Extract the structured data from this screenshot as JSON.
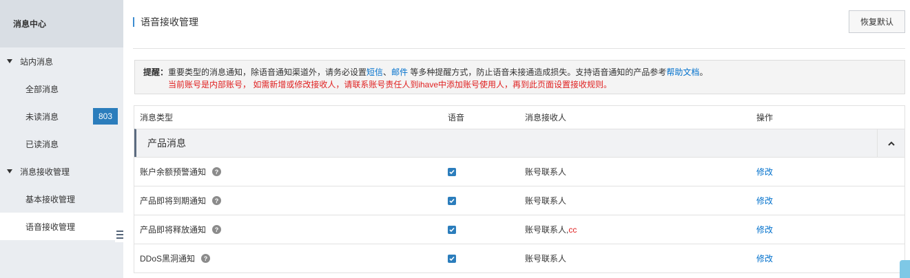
{
  "sidebar": {
    "title": "消息中心",
    "groups": [
      {
        "label": "站内消息"
      },
      {
        "label": "消息接收管理"
      }
    ],
    "items": [
      {
        "label": "全部消息"
      },
      {
        "label": "未读消息",
        "badge": "803"
      },
      {
        "label": "已读消息"
      },
      {
        "label": "基本接收管理"
      },
      {
        "label": "语音接收管理"
      }
    ]
  },
  "header": {
    "title": "语音接收管理",
    "restore_button": "恢复默认"
  },
  "tip": {
    "label": "提醒：",
    "text_before": "重要类型的消息通知，除语音通知渠道外，请务必设置",
    "link_sms": "短信",
    "sep": "、",
    "link_mail": "邮件",
    "text_mid": " 等多种提醒方式，防止语音未接通造成损失。支持语音通知的产品参考",
    "link_help": "帮助文档",
    "text_end": "。",
    "warning": "当前账号是内部账号， 如需新增或修改接收人，请联系账号责任人到ihave中添加账号使用人，再到此页面设置接收规则。"
  },
  "table": {
    "columns": [
      "消息类型",
      "语音",
      "消息接收人",
      "操作"
    ],
    "group_title": "产品消息",
    "rows": [
      {
        "type": "账户余额预警通知",
        "voice": true,
        "receiver": "账号联系人",
        "receiver_extra": "",
        "action": "修改"
      },
      {
        "type": "产品即将到期通知",
        "voice": true,
        "receiver": "账号联系人",
        "receiver_extra": "",
        "action": "修改"
      },
      {
        "type": "产品即将释放通知",
        "voice": true,
        "receiver": "账号联系人,",
        "receiver_extra": "cc",
        "action": "修改"
      },
      {
        "type": "DDoS黑洞通知",
        "voice": true,
        "receiver": "账号联系人",
        "receiver_extra": "",
        "action": "修改"
      }
    ],
    "help_glyph": "?"
  },
  "colors": {
    "accent": "#2b7dbc",
    "link": "#0070cc",
    "warning": "#e02020"
  }
}
